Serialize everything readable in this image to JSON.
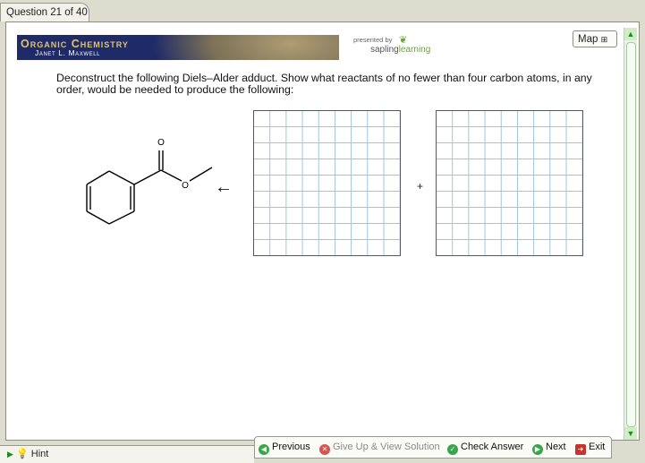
{
  "tab": {
    "label": "Question 21 of 40"
  },
  "banner": {
    "title": "Organic Chemistry",
    "author": "Janet L. Maxwell",
    "presented_by": "presented by",
    "brand_a": "sapling",
    "brand_b": "learning"
  },
  "map": {
    "label": "Map"
  },
  "question": {
    "text": "Deconstruct the following Diels–Alder adduct.  Show what reactants of no fewer than four carbon atoms, in any order, would be needed to produce the following:"
  },
  "molecule": {
    "atom_o_top": "O",
    "atom_o_ester": "O"
  },
  "reaction": {
    "arrow": "←",
    "plus": "+"
  },
  "hint": {
    "label": "Hint"
  },
  "nav": {
    "previous": "Previous",
    "give_up": "Give Up & View Solution",
    "check": "Check Answer",
    "next": "Next",
    "exit": "Exit"
  },
  "colors": {
    "banner": "#1f2a68",
    "grid_line": "#9fc4e1",
    "accent_green": "#39a64a"
  }
}
